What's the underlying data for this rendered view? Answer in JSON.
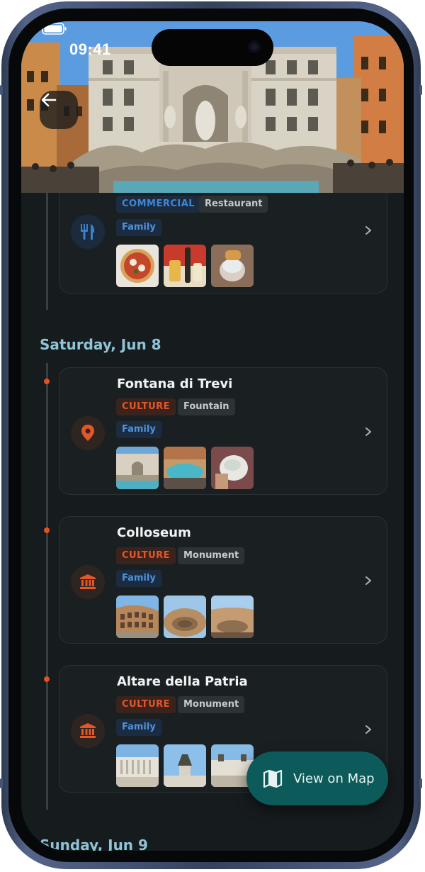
{
  "status_bar": {
    "time": "09:41"
  },
  "hero": {
    "image": "Trevi Fountain photo"
  },
  "colors": {
    "culture": "#e35628",
    "commercial": "#3f86d4",
    "accent_day": "#8fc4d6",
    "map_button": "#0c5a5a"
  },
  "first_card": {
    "category": "COMMERCIAL",
    "subcategory": "Restaurant",
    "audience": "Family",
    "icon": "utensils-icon",
    "thumbnails": [
      "pizza",
      "drinks",
      "gelato"
    ]
  },
  "days": [
    {
      "label": "Saturday, Jun 8",
      "places": [
        {
          "title": "Fontana di Trevi",
          "category": "CULTURE",
          "subcategory": "Fountain",
          "audience": "Family",
          "icon": "map-pin-icon",
          "thumbnails": [
            "trevi-fountain",
            "trevi-crowd",
            "gelato-cup"
          ]
        },
        {
          "title": "Colloseum",
          "category": "CULTURE",
          "subcategory": "Monument",
          "audience": "Family",
          "icon": "museum-icon",
          "thumbnails": [
            "colosseum-exterior",
            "colosseum-arena",
            "colosseum-inside"
          ]
        },
        {
          "title": "Altare della Patria",
          "category": "CULTURE",
          "subcategory": "Monument",
          "audience": "Family",
          "icon": "museum-icon",
          "thumbnails": [
            "vittoriano-front",
            "vittoriano-statue",
            "vittoriano-plaza"
          ]
        }
      ]
    },
    {
      "label": "Sunday, Jun 9",
      "places": []
    }
  ],
  "map_button": {
    "label": "View on Map",
    "icon": "map-icon"
  }
}
